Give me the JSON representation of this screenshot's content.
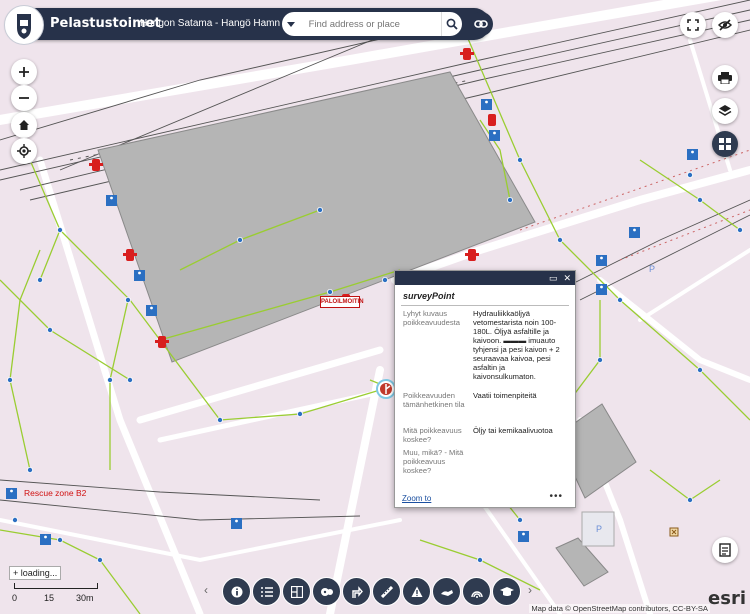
{
  "header": {
    "app_title": "Pelastustoimet",
    "subtitle": "Hangon Satama - Hangö Hamn Oy Ab",
    "search_placeholder": "Find address or place"
  },
  "map_labels": {
    "fire_alarm": "PALOILMOITIN",
    "rescue_zone": "Rescue zone B2",
    "parking": "P"
  },
  "popup": {
    "title": "surveyPoint",
    "fields": [
      {
        "label": "Lyhyt kuvaus poikkeavuudesta",
        "value": "Hydrauliikkaöljyä vetomestarista noin 100-180L. Öljyä asfaltille ja kaivoon. ▬▬▬ imuauto tyhjensi ja pesi kaivon + 2 seuraavaa kaivoa, pesi asfaltin ja kaivonsulkumaton."
      },
      {
        "label": "Poikkeavuuden tämänhetkinen tila",
        "value": "Vaatii toimenpiteitä"
      },
      {
        "label": "Mitä poikkeavuus koskee?",
        "value": "Öljy tai kemikaalivuotoa"
      },
      {
        "label": "Muu, mikä? - Mitä poikkeavuus koskee?",
        "value": ""
      }
    ],
    "zoom_link": "Zoom to",
    "more": "•••"
  },
  "status": {
    "loading": "loading..."
  },
  "scale": {
    "labels": [
      "0",
      "15",
      "30m"
    ]
  },
  "attribution": "Map data © OpenStreetMap contributors, CC-BY-SA",
  "esri_logo": "esri",
  "colors": {
    "header_bg": "#27324a",
    "map_bg": "#efe4ec",
    "building": "#b8b8b8",
    "hydrant": "#d81e1e",
    "valve": "#2b6fc2",
    "water_line": "#9acd32",
    "rail": "#444444"
  },
  "toolbar_icons": [
    "info-icon",
    "layer-list-icon",
    "basemap-gallery-icon",
    "bookmark-icon",
    "directions-icon",
    "measure-icon",
    "warning-icon",
    "survey-icon",
    "coverage-icon",
    "education-icon"
  ]
}
